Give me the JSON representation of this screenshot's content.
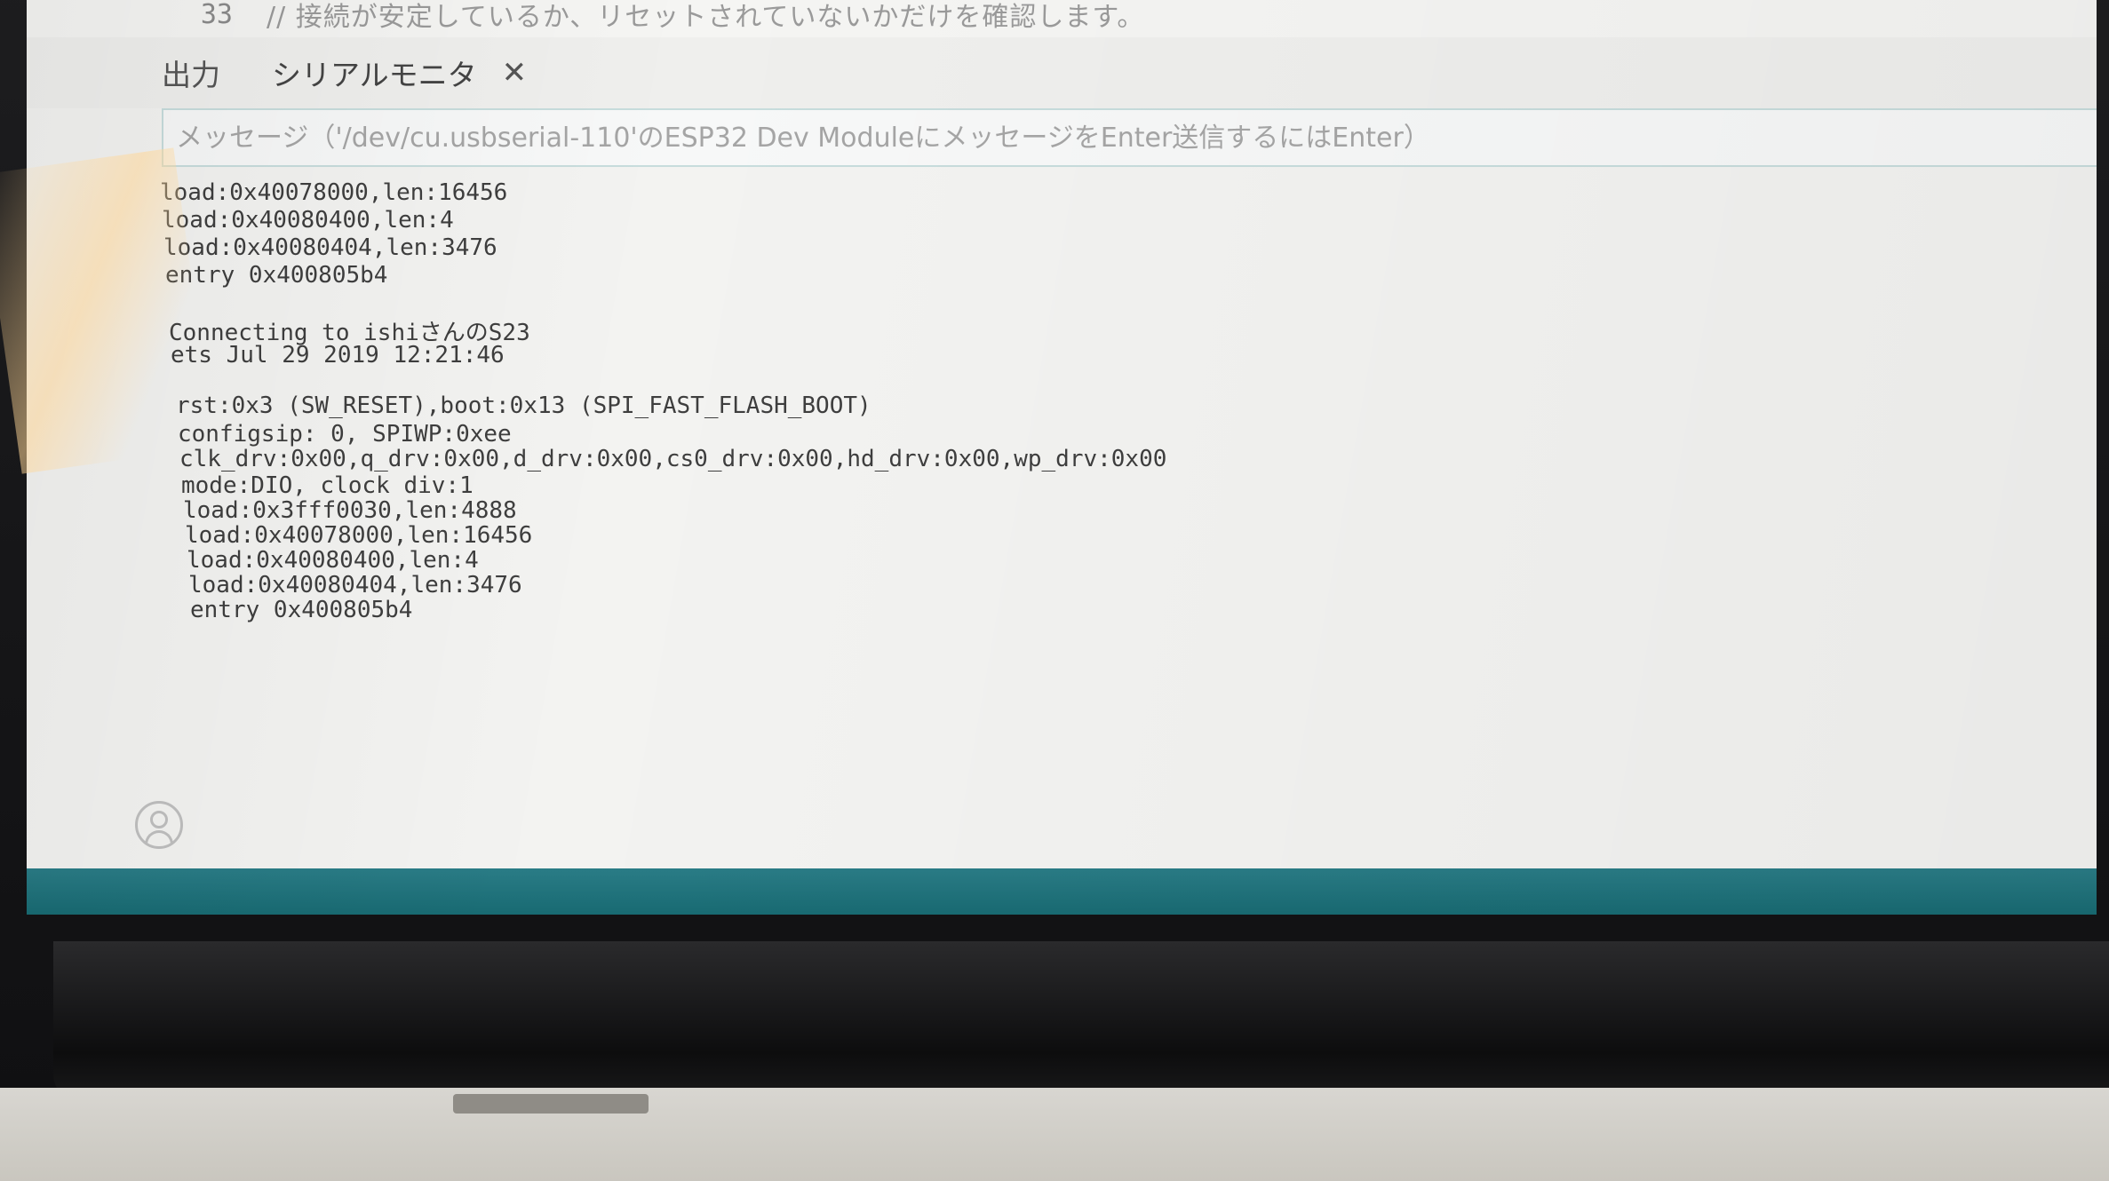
{
  "editor": {
    "line_number": "33",
    "line_text": "//  接続が安定しているか、リセットされていないかだけを確認します。"
  },
  "panel": {
    "tab_output": "出力",
    "tab_serial_monitor": "シリアルモニタ",
    "close_glyph": "✕"
  },
  "message_input": {
    "placeholder": "メッセージ（'/dev/cu.usbserial-110'のESP32 Dev ModuleにメッセージをEnter送信するにはEnter）",
    "value": ""
  },
  "serial_output": [
    "load:0x40078000,len:16456",
    "load:0x40080400,len:4",
    "load:0x40080404,len:3476",
    "entry 0x400805b4",
    "Connecting to ishiさんのS23",
    "ets Jul 29 2019 12:21:46",
    "rst:0x3 (SW_RESET),boot:0x13 (SPI_FAST_FLASH_BOOT)",
    "configsip: 0, SPIWP:0xee",
    "clk_drv:0x00,q_drv:0x00,d_drv:0x00,cs0_drv:0x00,hd_drv:0x00,wp_drv:0x00",
    "mode:DIO, clock div:1",
    "load:0x3fff0030,len:4888",
    "load:0x40078000,len:16456",
    "load:0x40080400,len:4",
    "load:0x40080404,len:3476",
    "entry 0x400805b4"
  ],
  "icons": {
    "account": "account-icon"
  },
  "colors": {
    "status_bar": "#1f737b",
    "input_border": "#c7dcdc",
    "console_text": "#3e3e3e"
  }
}
